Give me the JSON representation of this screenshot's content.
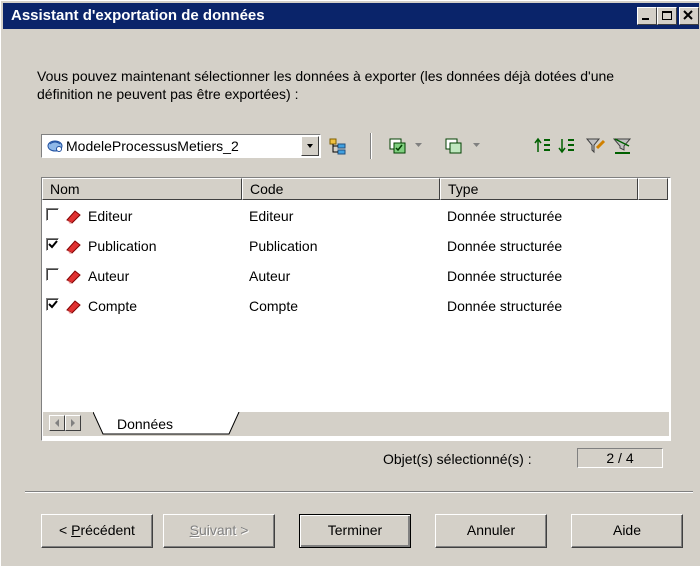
{
  "window": {
    "title": "Assistant d'exportation de données"
  },
  "intro": "Vous pouvez maintenant sélectionner les données à exporter (les données déjà dotées d'une définition ne peuvent pas être exportées) :",
  "model_selector": {
    "value": "ModeleProcessusMetiers_2",
    "icon": "model-icon"
  },
  "toolbar": {
    "icons": [
      "hierarchy-icon",
      "select-all-icon",
      "deselect-all-icon",
      "move-up-icon",
      "move-down-icon",
      "filter-icon",
      "clear-filter-icon"
    ]
  },
  "list": {
    "columns": [
      "Nom",
      "Code",
      "Type"
    ],
    "rows": [
      {
        "name": "Editeur",
        "code": "Editeur",
        "type": "Donnée structurée",
        "checked": false
      },
      {
        "name": "Publication",
        "code": "Publication",
        "type": "Donnée structurée",
        "checked": true
      },
      {
        "name": "Auteur",
        "code": "Auteur",
        "type": "Donnée structurée",
        "checked": false
      },
      {
        "name": "Compte",
        "code": "Compte",
        "type": "Donnée structurée",
        "checked": true
      }
    ],
    "tab": "Données"
  },
  "status": {
    "label": "Objet(s) sélectionné(s) :",
    "value": "2 / 4"
  },
  "buttons": {
    "previous_prefix": "< ",
    "previous_accel": "P",
    "previous_rest": "récédent",
    "next_accel": "S",
    "next_rest": "uivant >",
    "finish": "Terminer",
    "cancel": "Annuler",
    "help": "Aide"
  }
}
